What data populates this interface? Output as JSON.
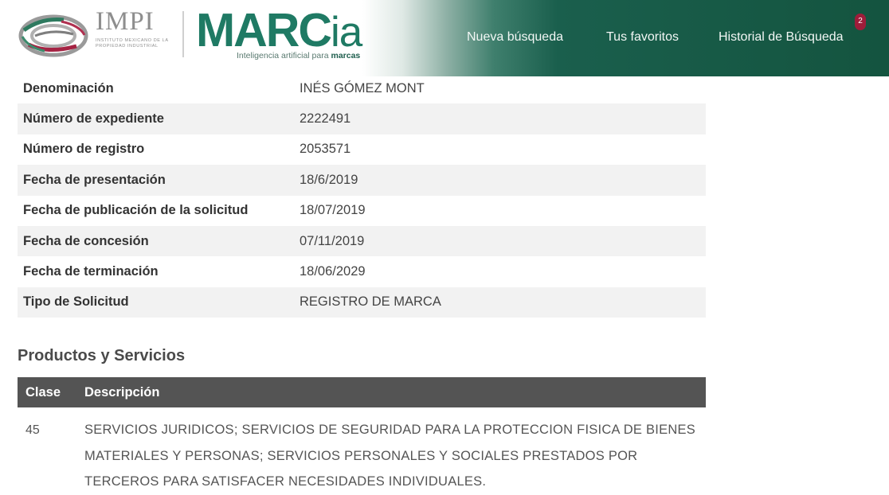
{
  "header": {
    "impi_title": "IMPI",
    "impi_subtitle": "INSTITUTO MEXICANO DE LA PROPIEDAD INDUSTRIAL",
    "brand_main": "MARC",
    "brand_suffix": "ia",
    "brand_tagline_prefix": "Inteligencia artificial para ",
    "brand_tagline_bold": "marcas",
    "nav": [
      {
        "label": "Nueva búsqueda"
      },
      {
        "label": "Tus favoritos"
      },
      {
        "label": "Historial de Búsqueda"
      }
    ],
    "history_badge": "2"
  },
  "details": [
    {
      "label": "Denominación",
      "value": "INÉS GÓMEZ MONT"
    },
    {
      "label": "Número de expediente",
      "value": "2222491"
    },
    {
      "label": "Número de registro",
      "value": "2053571"
    },
    {
      "label": "Fecha de presentación",
      "value": "18/6/2019"
    },
    {
      "label": "Fecha de publicación de la solicitud",
      "value": "18/07/2019"
    },
    {
      "label": "Fecha de concesión",
      "value": "07/11/2019"
    },
    {
      "label": "Fecha de terminación",
      "value": "18/06/2029"
    },
    {
      "label": "Tipo de Solicitud",
      "value": "REGISTRO DE MARCA"
    }
  ],
  "products": {
    "title": "Productos y Servicios",
    "headers": {
      "clase": "Clase",
      "descripcion": "Descripción"
    },
    "rows": [
      {
        "clase": "45",
        "descripcion": "SERVICIOS JURIDICOS; SERVICIOS DE SEGURIDAD PARA LA PROTECCION FISICA DE BIENES MATERIALES Y PERSONAS; SERVICIOS PERSONALES Y SOCIALES PRESTADOS POR TERCEROS PARA SATISFACER NECESIDADES INDIVIDUALES."
      }
    ]
  },
  "colors": {
    "brand_green": "#1f7a64",
    "header_dark_green": "#14543f",
    "badge_red": "#9d1d3a",
    "table_header": "#545454",
    "row_stripe": "#f2f2f2"
  }
}
